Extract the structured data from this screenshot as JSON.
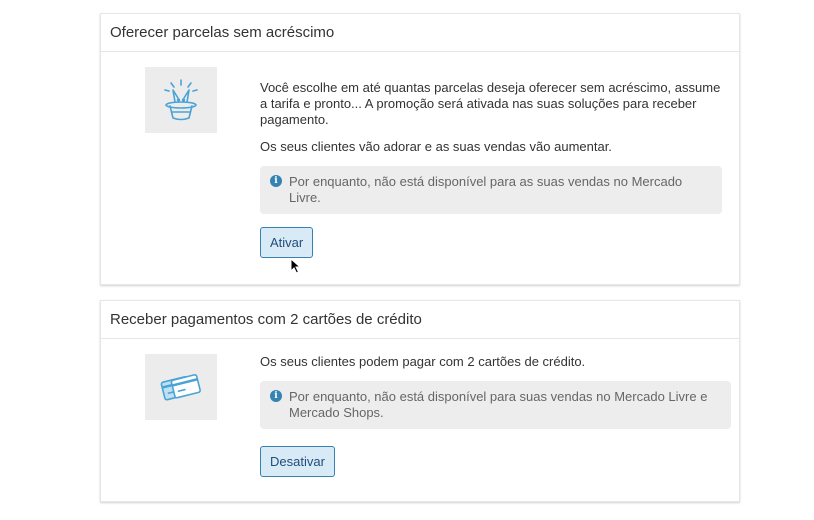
{
  "offer_installments": {
    "title": "Oferecer parcelas sem acréscimo",
    "illustration": "magic-hat-icon",
    "description": "Você escolhe em até quantas parcelas deseja oferecer sem acréscimo, assume a tarifa e pronto... A promoção será ativada nas suas soluções para receber pagamento.",
    "subtext": "Os seus clientes vão adorar e as suas vendas vão aumentar.",
    "notice": "Por enquanto, não está disponível para as suas vendas no Mercado Livre.",
    "button_label": "Ativar"
  },
  "two_cards": {
    "title": "Receber pagamentos com 2 cartões de crédito",
    "illustration": "credit-cards-icon",
    "description": "Os seus clientes podem pagar com 2 cartões de crédito.",
    "notice": "Por enquanto, não está disponível para suas vendas no Mercado Livre e Mercado Shops.",
    "button_label": "Desativar"
  },
  "colors": {
    "accent": "#3483b3",
    "button_bg": "#d9eaf7",
    "illustration": "#4aa3d6",
    "notice_bg": "#ededed"
  },
  "info_icon": "info-icon",
  "info_glyph": "i"
}
